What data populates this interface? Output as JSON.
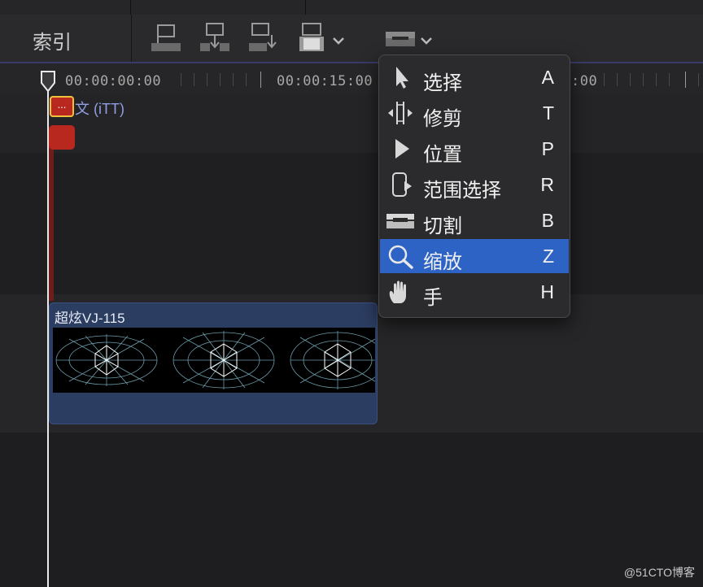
{
  "toolbar": {
    "index_label": "索引",
    "buttons": [
      {
        "icon": "connect-clip-icon"
      },
      {
        "icon": "insert-clip-icon"
      },
      {
        "icon": "append-clip-icon"
      },
      {
        "icon": "overwrite-clip-icon"
      },
      {
        "icon": "blade-tool-icon"
      }
    ]
  },
  "ruler": {
    "timecodes": [
      "00:00:00:00",
      "00:00:15:00",
      ":00"
    ]
  },
  "timeline": {
    "caption_chip": "...",
    "caption_label": "文 (iTT)",
    "clip_title": "超炫VJ-115"
  },
  "tool_menu": {
    "items": [
      {
        "label": "选择",
        "shortcut": "A",
        "icon": "arrow-pointer-icon",
        "selected": false
      },
      {
        "label": "修剪",
        "shortcut": "T",
        "icon": "trim-icon",
        "selected": false
      },
      {
        "label": "位置",
        "shortcut": "P",
        "icon": "position-arrow-icon",
        "selected": false
      },
      {
        "label": "范围选择",
        "shortcut": "R",
        "icon": "range-select-icon",
        "selected": false
      },
      {
        "label": "切割",
        "shortcut": "B",
        "icon": "blade-icon",
        "selected": false
      },
      {
        "label": "缩放",
        "shortcut": "Z",
        "icon": "magnifier-icon",
        "selected": true
      },
      {
        "label": "手",
        "shortcut": "H",
        "icon": "hand-icon",
        "selected": false
      }
    ],
    "selected_color": "#2e63c6"
  },
  "watermark": "@51CTO博客"
}
